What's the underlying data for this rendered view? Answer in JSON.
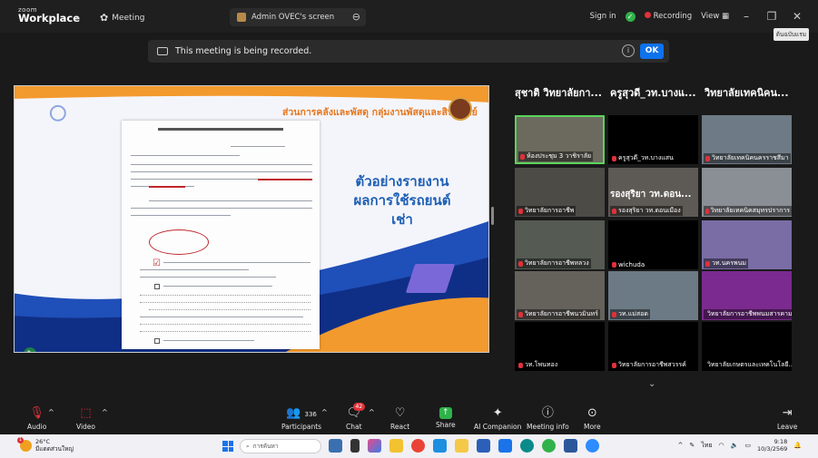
{
  "titlebar": {
    "brand_small": "zoom",
    "brand_big": "Workplace",
    "meeting_label": "Meeting",
    "share_tab_label": "Admin OVEC's screen",
    "sign_in": "Sign in",
    "recording": "Recording",
    "view": "View",
    "tooltip": "ต้นฉบับแรม"
  },
  "banner": {
    "text": "This meeting is being recorded.",
    "ok_label": "OK"
  },
  "shared_screen": {
    "slide_header": "ส่วนการคลังและพัสดุ กลุ่มงานพัสดุและสินทรัพย์",
    "slide_title": "ตัวอย่างรายงานผลการใช้รถยนต์เช่า"
  },
  "gallery": {
    "top_names": [
      "สุชาติ วิทยาลัยกา...",
      "ครูสุวดี_วท.บางแ...",
      "วิทยาลัยเทคนิคน..."
    ],
    "tiles": [
      {
        "label": "ห้องประชุม 3 วาชิราลัย",
        "big": "",
        "video": true,
        "active": true
      },
      {
        "label": "ครูสุวดี_วท.บางแสน",
        "big": "",
        "video": false,
        "active": false
      },
      {
        "label": "วิทยาลัยเทคนิคนครราชสีมา",
        "big": "",
        "video": true,
        "active": false
      },
      {
        "label": "วิทยาลัยการอาชีพ",
        "big": "",
        "video": true,
        "active": false
      },
      {
        "label": "รองสุริยา วท.ดอนเมือง",
        "big": "รองสุริยา วท.ดอน...",
        "video": true,
        "active": false
      },
      {
        "label": "วิทยาลัยเทคนิคสมุทรปราการ",
        "big": "",
        "video": true,
        "active": false
      },
      {
        "label": "วิทยาลัยการอาชีพหลวง",
        "big": "",
        "video": true,
        "active": false
      },
      {
        "label": "wichuda",
        "big": "",
        "video": false,
        "active": false
      },
      {
        "label": "วท.นครพนม",
        "big": "",
        "video": true,
        "active": false
      },
      {
        "label": "วิทยาลัยการอาชีพนวมินทร์",
        "big": "",
        "video": true,
        "active": false
      },
      {
        "label": "วท.แม่สอด",
        "big": "",
        "video": true,
        "active": false
      },
      {
        "label": "วิทยาลัยการอาชีพพนมสารคาม",
        "big": "",
        "video": true,
        "active": false
      },
      {
        "label": "วท.โพนทอง",
        "big": "",
        "video": false,
        "active": false
      },
      {
        "label": "วิทยาลัยการอาชีพสวรรค์",
        "big": "",
        "video": false,
        "active": false
      },
      {
        "label": "วิทยาลัยเกษตรและเทคโนโลยี...",
        "big": "",
        "video": false,
        "active": false
      }
    ]
  },
  "toolbar": {
    "audio": "Audio",
    "video": "Video",
    "participants": "Participants",
    "participants_count": "336",
    "chat": "Chat",
    "chat_badge": "42",
    "react": "React",
    "share": "Share",
    "ai_companion": "AI Companion",
    "meeting_info": "Meeting info",
    "more": "More",
    "leave": "Leave"
  },
  "taskbar": {
    "temp": "26°C",
    "weather_desc": "มีแดดส่วนใหญ่",
    "weather_badge": "1",
    "search_placeholder": "การค้นหา",
    "lang": "ไทย",
    "time": "9:18",
    "date": "10/3/2569"
  }
}
